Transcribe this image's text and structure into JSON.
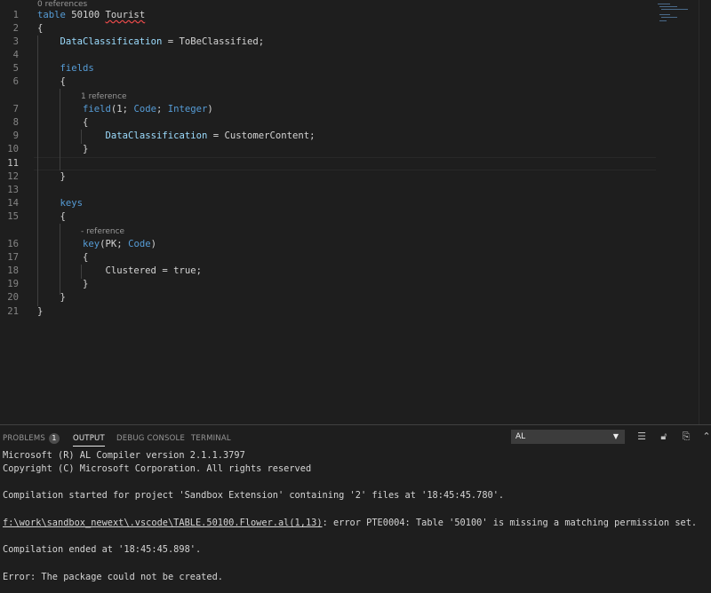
{
  "editor": {
    "code_lens": {
      "table": "0 references",
      "field": "1 reference",
      "key": "- reference"
    },
    "lines": [
      {
        "n": "1",
        "segs": [
          [
            "kw",
            "table"
          ],
          [
            "pl",
            " 50100 "
          ],
          [
            "sq",
            "Tourist"
          ]
        ]
      },
      {
        "n": "2",
        "segs": [
          [
            "pl",
            "{"
          ]
        ]
      },
      {
        "n": "3",
        "segs": [
          [
            "pl",
            "    "
          ],
          [
            "prop",
            "DataClassification"
          ],
          [
            "pl",
            " = ToBeClassified;"
          ]
        ]
      },
      {
        "n": "4",
        "segs": []
      },
      {
        "n": "5",
        "segs": [
          [
            "pl",
            "    "
          ],
          [
            "kw",
            "fields"
          ]
        ]
      },
      {
        "n": "6",
        "segs": [
          [
            "pl",
            "    {"
          ]
        ]
      },
      {
        "n": "7",
        "segs": [
          [
            "pl",
            "        "
          ],
          [
            "kw",
            "field"
          ],
          [
            "pl",
            "(1; "
          ],
          [
            "kw",
            "Code"
          ],
          [
            "pl",
            "; "
          ],
          [
            "kw",
            "Integer"
          ],
          [
            "pl",
            ")"
          ]
        ]
      },
      {
        "n": "8",
        "segs": [
          [
            "pl",
            "        {"
          ]
        ]
      },
      {
        "n": "9",
        "segs": [
          [
            "pl",
            "            "
          ],
          [
            "prop",
            "DataClassification"
          ],
          [
            "pl",
            " = CustomerContent;"
          ]
        ]
      },
      {
        "n": "10",
        "segs": [
          [
            "pl",
            "        }"
          ]
        ]
      },
      {
        "n": "11",
        "segs": []
      },
      {
        "n": "12",
        "segs": [
          [
            "pl",
            "    }"
          ]
        ]
      },
      {
        "n": "13",
        "segs": []
      },
      {
        "n": "14",
        "segs": [
          [
            "pl",
            "    "
          ],
          [
            "kw",
            "keys"
          ]
        ]
      },
      {
        "n": "15",
        "segs": [
          [
            "pl",
            "    {"
          ]
        ]
      },
      {
        "n": "16",
        "segs": [
          [
            "pl",
            "        "
          ],
          [
            "kw",
            "key"
          ],
          [
            "pl",
            "(PK; "
          ],
          [
            "kw",
            "Code"
          ],
          [
            "pl",
            ")"
          ]
        ]
      },
      {
        "n": "17",
        "segs": [
          [
            "pl",
            "        {"
          ]
        ]
      },
      {
        "n": "18",
        "segs": [
          [
            "pl",
            "            Clustered = true;"
          ]
        ]
      },
      {
        "n": "19",
        "segs": [
          [
            "pl",
            "        }"
          ]
        ]
      },
      {
        "n": "20",
        "segs": [
          [
            "pl",
            "    }"
          ]
        ]
      },
      {
        "n": "21",
        "segs": [
          [
            "pl",
            "}"
          ]
        ]
      }
    ]
  },
  "panel": {
    "tabs": {
      "problems": "PROBLEMS",
      "problems_count": "1",
      "output": "OUTPUT",
      "debug_console": "DEBUG CONSOLE",
      "terminal": "TERMINAL"
    },
    "channel": "AL",
    "icons": {
      "clear": "clear-output-icon",
      "lock": "scroll-lock-icon",
      "open": "open-log-icon",
      "maximize": "maximize-panel-icon"
    },
    "output": {
      "l1": "Microsoft (R) AL Compiler version 2.1.1.3797",
      "l2": "Copyright (C) Microsoft Corporation. All rights reserved",
      "l3": "Compilation started for project 'Sandbox Extension' containing '2' files at '18:45:45.780'.",
      "l4_link": "f:\\work\\sandbox_newext\\.vscode\\TABLE.50100.Flower.al(1,13)",
      "l4_rest": ": error PTE0004: Table '50100' is missing a matching permission set.",
      "l5": "Compilation ended at '18:45:45.898'.",
      "l6": "Error: The package could not be created."
    }
  }
}
